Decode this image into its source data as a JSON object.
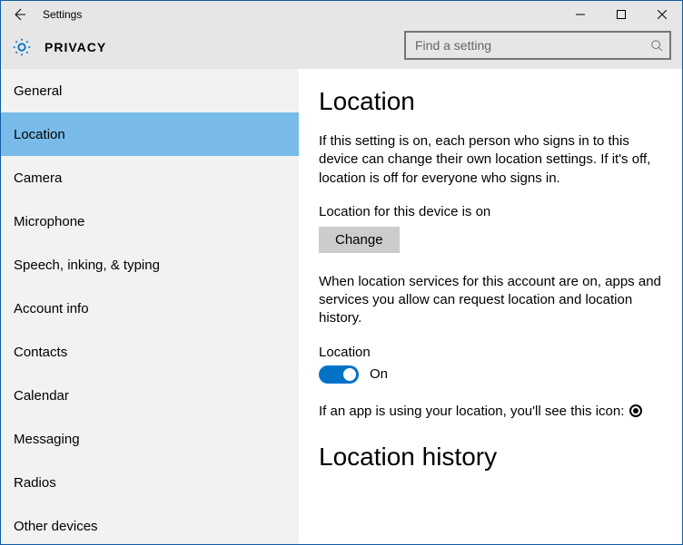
{
  "title": "Settings",
  "headerTitle": "PRIVACY",
  "search": {
    "placeholder": "Find a setting"
  },
  "sidebar": {
    "items": [
      {
        "label": "General",
        "active": false,
        "name": "sidebar-item-general"
      },
      {
        "label": "Location",
        "active": true,
        "name": "sidebar-item-location"
      },
      {
        "label": "Camera",
        "active": false,
        "name": "sidebar-item-camera"
      },
      {
        "label": "Microphone",
        "active": false,
        "name": "sidebar-item-microphone"
      },
      {
        "label": "Speech, inking, & typing",
        "active": false,
        "name": "sidebar-item-speech-inking-typing"
      },
      {
        "label": "Account info",
        "active": false,
        "name": "sidebar-item-account-info"
      },
      {
        "label": "Contacts",
        "active": false,
        "name": "sidebar-item-contacts"
      },
      {
        "label": "Calendar",
        "active": false,
        "name": "sidebar-item-calendar"
      },
      {
        "label": "Messaging",
        "active": false,
        "name": "sidebar-item-messaging"
      },
      {
        "label": "Radios",
        "active": false,
        "name": "sidebar-item-radios"
      },
      {
        "label": "Other devices",
        "active": false,
        "name": "sidebar-item-other-devices"
      }
    ]
  },
  "main": {
    "heading": "Location",
    "intro": "If this setting is on, each person who signs in to this device can change their own location settings. If it's off, location is off for everyone who signs in.",
    "deviceStatusLabel": "Location for this device is on",
    "changeBtn": "Change",
    "accountNote": "When location services for this account are on, apps and services you allow can request location and location history.",
    "toggleLabel": "Location",
    "toggleState": "On",
    "iconNote": "If an app is using your location, you'll see this icon:",
    "historyHeading": "Location history"
  }
}
